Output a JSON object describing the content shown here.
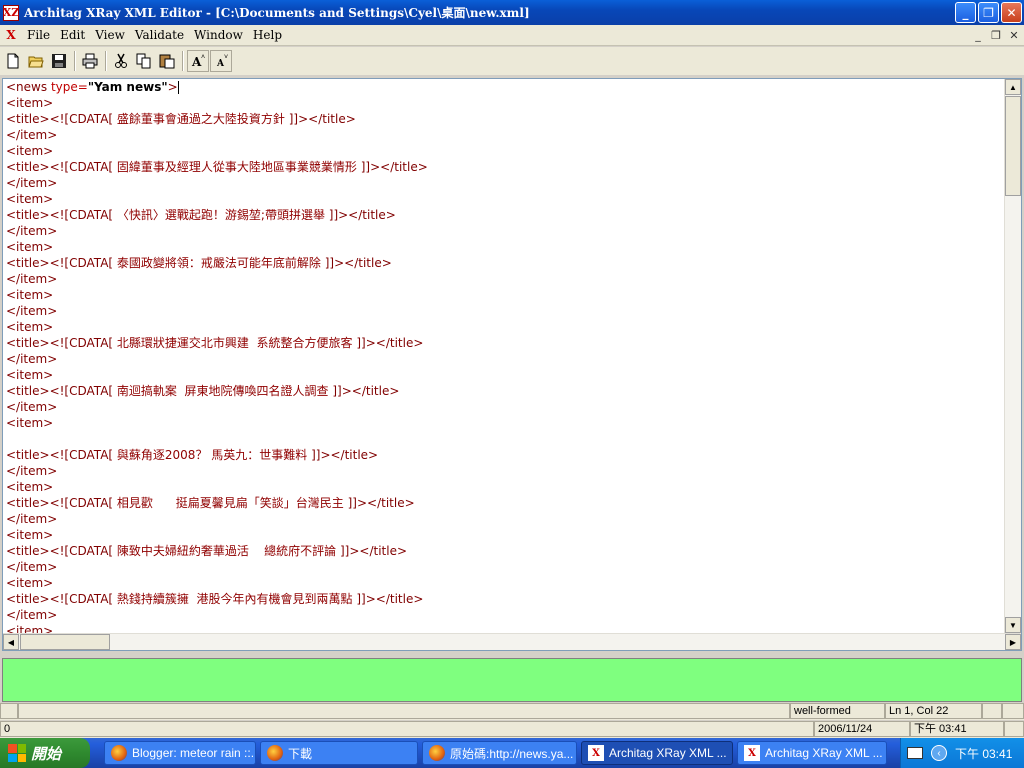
{
  "window": {
    "app_icon": "XZ",
    "title": "Architag XRay XML Editor - [C:\\Documents and Settings\\Cyel\\桌面\\new.xml]",
    "controls": [
      "minimize-icon",
      "restore-icon",
      "close-icon"
    ]
  },
  "menu": {
    "items": [
      "File",
      "Edit",
      "View",
      "Validate",
      "Window",
      "Help"
    ],
    "mdi_controls": [
      "minimize-icon",
      "restore-icon",
      "close-icon"
    ]
  },
  "toolbar": {
    "icons": [
      "new-file-icon",
      "open-folder-icon",
      "save-icon",
      "print-icon",
      "cut-icon",
      "copy-icon",
      "paste-icon",
      "font-larger-icon",
      "font-smaller-icon"
    ]
  },
  "editor": {
    "lines": [
      {
        "kind": "root",
        "tag_open": "<news ",
        "attr": "type=",
        "value": "\"Yam news\"",
        "tag_close": ">"
      },
      {
        "kind": "plain",
        "text": "<item>"
      },
      {
        "kind": "title",
        "open": "<title><![CDATA[ ",
        "text": "盛餘董事會通過之大陸投資方針",
        "close": " ]]></title>"
      },
      {
        "kind": "plain",
        "text": "</item>"
      },
      {
        "kind": "plain",
        "text": "<item>"
      },
      {
        "kind": "title",
        "open": "<title><![CDATA[ ",
        "text": "固緯董事及經理人從事大陸地區事業競業情形",
        "close": " ]]></title>"
      },
      {
        "kind": "plain",
        "text": "</item>"
      },
      {
        "kind": "plain",
        "text": "<item>"
      },
      {
        "kind": "title",
        "open": "<title><![CDATA[ ",
        "text": "〈快訊〉選戰起跑！游錫堃;帶頭拼選舉",
        "close": " ]]></title>"
      },
      {
        "kind": "plain",
        "text": "</item>"
      },
      {
        "kind": "plain",
        "text": "<item>"
      },
      {
        "kind": "title",
        "open": "<title><![CDATA[ ",
        "text": "泰國政變將領：戒嚴法可能年底前解除",
        "close": " ]]></title>"
      },
      {
        "kind": "plain",
        "text": "</item>"
      },
      {
        "kind": "plain",
        "text": "<item>"
      },
      {
        "kind": "plain",
        "text": "</item>"
      },
      {
        "kind": "plain",
        "text": "<item>"
      },
      {
        "kind": "title",
        "open": "<title><![CDATA[ ",
        "text": "北縣環狀捷運交北市興建  系統整合方便旅客",
        "close": " ]]></title>"
      },
      {
        "kind": "plain",
        "text": "</item>"
      },
      {
        "kind": "plain",
        "text": "<item>"
      },
      {
        "kind": "title",
        "open": "<title><![CDATA[ ",
        "text": "南迴搞軌案  屏東地院傳喚四名證人調查",
        "close": " ]]></title>"
      },
      {
        "kind": "plain",
        "text": "</item>"
      },
      {
        "kind": "plain",
        "text": "<item>"
      },
      {
        "kind": "plain",
        "text": ""
      },
      {
        "kind": "title",
        "open": "<title><![CDATA[ ",
        "text": "與蘇角逐2008？ 馬英九：世事難料",
        "close": " ]]></title>"
      },
      {
        "kind": "plain",
        "text": "</item>"
      },
      {
        "kind": "plain",
        "text": "<item>"
      },
      {
        "kind": "title",
        "open": "<title><![CDATA[ ",
        "text": "相見歡      挺扁夏馨見扁「笑談」台灣民主",
        "close": " ]]></title>"
      },
      {
        "kind": "plain",
        "text": "</item>"
      },
      {
        "kind": "plain",
        "text": "<item>"
      },
      {
        "kind": "title",
        "open": "<title><![CDATA[ ",
        "text": "陳致中夫婦紐約奢華過活    總統府不評論",
        "close": " ]]></title>"
      },
      {
        "kind": "plain",
        "text": "</item>"
      },
      {
        "kind": "plain",
        "text": "<item>"
      },
      {
        "kind": "title",
        "open": "<title><![CDATA[ ",
        "text": "熱錢持續簇擁  港股今年內有機會見到兩萬點",
        "close": " ]]></title>"
      },
      {
        "kind": "plain",
        "text": "</item>"
      },
      {
        "kind": "plain",
        "text": "<item>"
      }
    ]
  },
  "status": {
    "wellformed": "well-formed",
    "position": "Ln 1, Col 22",
    "count": "0",
    "date": "2006/11/24",
    "time": "下午 03:41"
  },
  "taskbar": {
    "start_label": "開始",
    "tasks": [
      {
        "label": "Blogger: meteor rain ::...",
        "icon": "firefox-icon",
        "active": false
      },
      {
        "label": "下載",
        "icon": "firefox-icon",
        "active": false
      },
      {
        "label": "原始碼:http://news.ya...",
        "icon": "firefox-icon",
        "active": false
      },
      {
        "label": "Architag XRay XML ...",
        "icon": "xray-icon",
        "active": true
      },
      {
        "label": "Architag XRay XML ...",
        "icon": "xray-icon",
        "active": false
      }
    ],
    "clock": "下午 03:41"
  }
}
